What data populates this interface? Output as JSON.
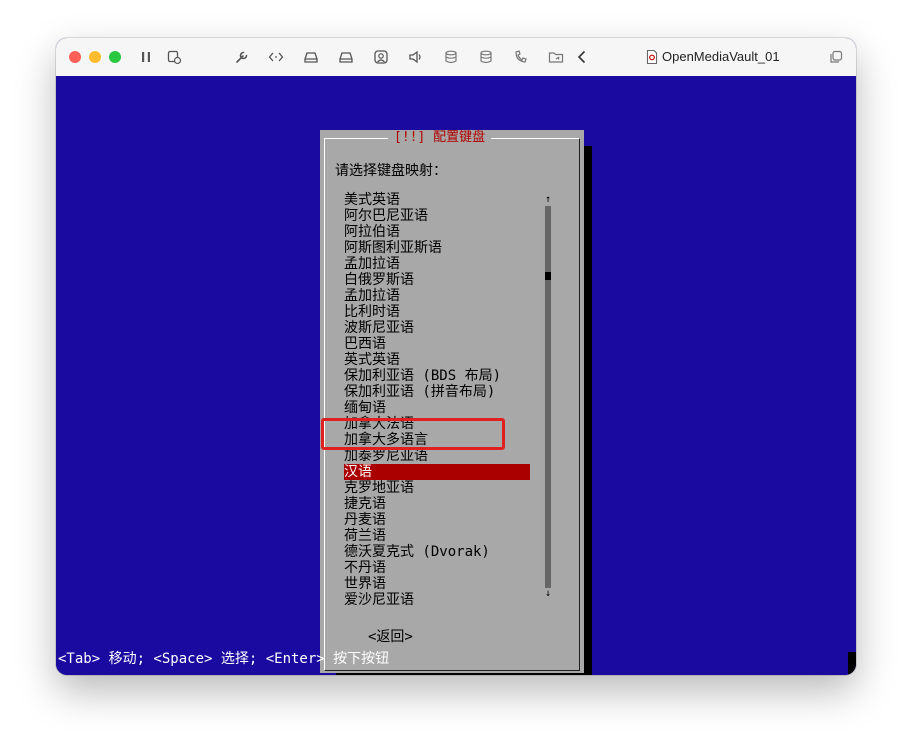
{
  "window": {
    "title": "OpenMediaVault_01",
    "traffic_lights": {
      "close": "#fe5f57",
      "minimize": "#febc2e",
      "zoom": "#28c840"
    },
    "toolbar_icons": [
      "pause-icon",
      "snapshot-icon",
      "wrench-icon",
      "code-icon",
      "hard-disk-icon",
      "drive-icon",
      "user-icon",
      "speaker-icon",
      "disk-stack-icon",
      "disk-stack-icon",
      "usb-icon",
      "folder-share-icon",
      "chevron-left-icon",
      "document-icon",
      "copy-icon"
    ]
  },
  "dialog": {
    "title": "[!!] 配置键盘",
    "prompt": "请选择键盘映射：",
    "items": [
      "美式英语",
      "阿尔巴尼亚语",
      "阿拉伯语",
      "阿斯图利亚斯语",
      "孟加拉语",
      "白俄罗斯语",
      "孟加拉语",
      "比利时语",
      "波斯尼亚语",
      "巴西语",
      "英式英语",
      "保加利亚语 (BDS 布局)",
      "保加利亚语 (拼音布局)",
      "缅甸语",
      "加拿大法语",
      "加拿大多语言",
      "加泰罗尼亚语",
      "汉语",
      "克罗地亚语",
      "捷克语",
      "丹麦语",
      "荷兰语",
      "德沃夏克式 (Dvorak)",
      "不丹语",
      "世界语",
      "爱沙尼亚语"
    ],
    "selected_index": 17,
    "back_button": "<返回>",
    "scroll_up": "↑",
    "scroll_down": "↓"
  },
  "status_bar": "<Tab> 移动; <Space> 选择; <Enter> 按下按钮",
  "colors": {
    "screen_bg": "#1a0aa0",
    "dialog_bg": "#a8a8a8",
    "title_red": "#b00000",
    "selection_bg": "#aa0000",
    "highlight_box": "#e02020"
  }
}
